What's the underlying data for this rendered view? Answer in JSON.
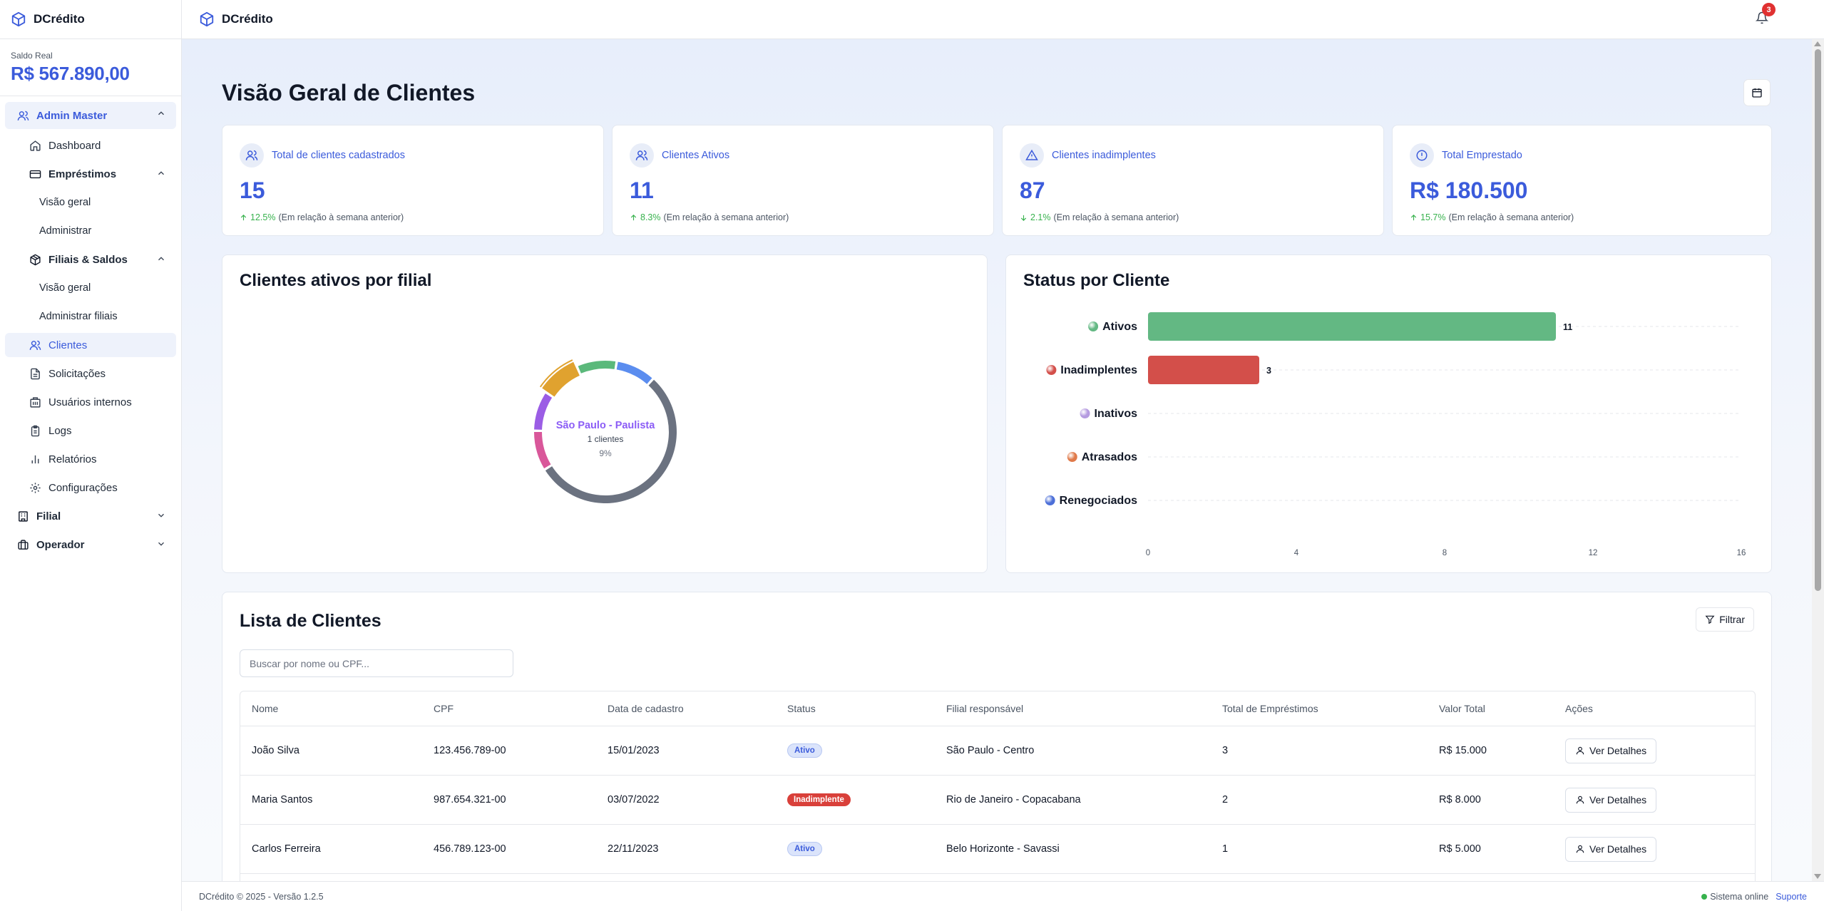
{
  "app": {
    "brand": "DCrédito"
  },
  "sidebar": {
    "balance_label": "Saldo Real",
    "balance_value": "R$ 567.890,00",
    "admin_group": "Admin Master",
    "items": {
      "dashboard": "Dashboard",
      "emprestimos": "Empréstimos",
      "emp_visao": "Visão geral",
      "emp_admin": "Administrar",
      "filiais": "Filiais & Saldos",
      "fil_visao": "Visão geral",
      "fil_admin": "Administrar filiais",
      "clientes": "Clientes",
      "solicitacoes": "Solicitações",
      "usuarios": "Usuários internos",
      "logs": "Logs",
      "relatorios": "Relatórios",
      "configuracoes": "Configurações"
    },
    "filial_group": "Filial",
    "operador_group": "Operador"
  },
  "topbar": {
    "title": "DCrédito",
    "notifications": "3"
  },
  "page": {
    "title": "Visão Geral de Clientes"
  },
  "stats": [
    {
      "label": "Total de clientes cadastrados",
      "value": "15",
      "change": "12.5%",
      "direction": "up",
      "note": "(Em relação à semana anterior)",
      "icon": "users-icon"
    },
    {
      "label": "Clientes Ativos",
      "value": "11",
      "change": "8.3%",
      "direction": "up",
      "note": "(Em relação à semana anterior)",
      "icon": "users-icon"
    },
    {
      "label": "Clientes inadimplentes",
      "value": "87",
      "change": "2.1%",
      "direction": "down",
      "note": "(Em relação à semana anterior)",
      "icon": "alert-triangle-icon"
    },
    {
      "label": "Total Emprestado",
      "value": "R$ 180.500",
      "change": "15.7%",
      "direction": "up",
      "note": "(Em relação à semana anterior)",
      "icon": "alert-circle-icon"
    }
  ],
  "chart_data": [
    {
      "type": "pie",
      "title": "Clientes ativos por filial",
      "center_label": "São Paulo - Paulista",
      "center_value": "1 clientes",
      "center_percent": "9%",
      "highlighted_index": 4,
      "slices": [
        {
          "value": 1,
          "color": "#5b8def"
        },
        {
          "value": 6,
          "color": "#6b7280"
        },
        {
          "value": 1,
          "color": "#d9579a"
        },
        {
          "value": 1,
          "color": "#9b5de5"
        },
        {
          "value": 1,
          "color": "#e0a22f"
        },
        {
          "value": 1,
          "color": "#5bb97b"
        }
      ]
    },
    {
      "type": "bar",
      "orientation": "horizontal",
      "title": "Status por Cliente",
      "categories": [
        "Ativos",
        "Inadimplentes",
        "Inativos",
        "Atrasados",
        "Renegociados"
      ],
      "values": [
        11,
        3,
        0,
        0,
        0
      ],
      "data_labels": [
        "11",
        "3",
        "",
        "",
        ""
      ],
      "colors": [
        "#63b883",
        "#d34f4a",
        "#b59be0",
        "#e07a4a",
        "#4c6fd8"
      ],
      "xlim": [
        0,
        16
      ],
      "xticks": [
        "0",
        "4",
        "8",
        "12",
        "16"
      ],
      "grid": true
    }
  ],
  "clients": {
    "title": "Lista de Clientes",
    "filter_label": "Filtrar",
    "search_placeholder": "Buscar por nome ou CPF...",
    "columns": [
      "Nome",
      "CPF",
      "Data de cadastro",
      "Status",
      "Filial responsável",
      "Total de Empréstimos",
      "Valor Total",
      "Ações"
    ],
    "rows": [
      {
        "nome": "João Silva",
        "cpf": "123.456.789-00",
        "data": "15/01/2023",
        "status": "Ativo",
        "filial": "São Paulo - Centro",
        "total": "3",
        "valor": "R$ 15.000",
        "acao": "Ver Detalhes"
      },
      {
        "nome": "Maria Santos",
        "cpf": "987.654.321-00",
        "data": "03/07/2022",
        "status": "Inadimplente",
        "filial": "Rio de Janeiro - Copacabana",
        "total": "2",
        "valor": "R$ 8.000",
        "acao": "Ver Detalhes"
      },
      {
        "nome": "Carlos Ferreira",
        "cpf": "456.789.123-00",
        "data": "22/11/2023",
        "status": "Ativo",
        "filial": "Belo Horizonte - Savassi",
        "total": "1",
        "valor": "R$ 5.000",
        "acao": "Ver Detalhes"
      }
    ]
  },
  "footer": {
    "copyright": "DCrédito © 2025 - Versão 1.2.5",
    "status": "Sistema online",
    "support": "Suporte"
  },
  "colors": {
    "accent": "#3b5bdb",
    "positive": "#37b24d",
    "danger": "#e03131"
  }
}
